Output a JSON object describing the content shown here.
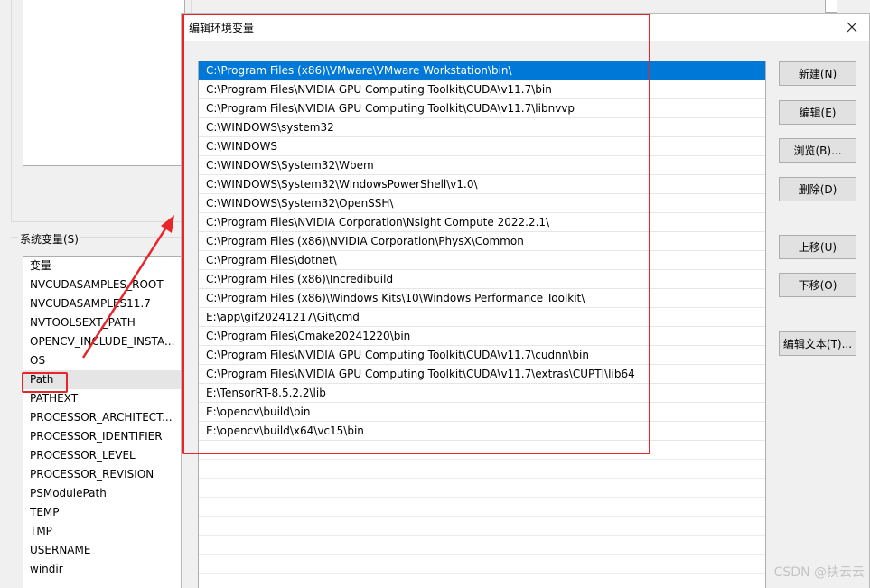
{
  "system_vars": {
    "group_label": "系统变量(S)",
    "column_header": "变量",
    "items": [
      "NVCUDASAMPLES_ROOT",
      "NVCUDASAMPLES11.7",
      "NVTOOLSEXT_PATH",
      "OPENCV_INCLUDE_INSTA...",
      "OS",
      "Path",
      "PATHEXT",
      "PROCESSOR_ARCHITECT...",
      "PROCESSOR_IDENTIFIER",
      "PROCESSOR_LEVEL",
      "PROCESSOR_REVISION",
      "PSModulePath",
      "TEMP",
      "TMP",
      "USERNAME",
      "windir"
    ],
    "selected": "Path"
  },
  "edit_dialog": {
    "title": "编辑环境变量",
    "paths": [
      "C:\\Program Files (x86)\\VMware\\VMware Workstation\\bin\\",
      "C:\\Program Files\\NVIDIA GPU Computing Toolkit\\CUDA\\v11.7\\bin",
      "C:\\Program Files\\NVIDIA GPU Computing Toolkit\\CUDA\\v11.7\\libnvvp",
      "C:\\WINDOWS\\system32",
      "C:\\WINDOWS",
      "C:\\WINDOWS\\System32\\Wbem",
      "C:\\WINDOWS\\System32\\WindowsPowerShell\\v1.0\\",
      "C:\\WINDOWS\\System32\\OpenSSH\\",
      "C:\\Program Files\\NVIDIA Corporation\\Nsight Compute 2022.2.1\\",
      "C:\\Program Files (x86)\\NVIDIA Corporation\\PhysX\\Common",
      "C:\\Program Files\\dotnet\\",
      "C:\\Program Files (x86)\\Incredibuild",
      "C:\\Program Files (x86)\\Windows Kits\\10\\Windows Performance Toolkit\\",
      "E:\\app\\gif20241217\\Git\\cmd",
      "C:\\Program Files\\Cmake20241220\\bin",
      "C:\\Program Files\\NVIDIA GPU Computing Toolkit\\CUDA\\v11.7\\cudnn\\bin",
      "C:\\Program Files\\NVIDIA GPU Computing Toolkit\\CUDA\\v11.7\\extras\\CUPTI\\lib64",
      "E:\\TensorRT-8.5.2.2\\lib",
      "E:\\opencv\\build\\bin",
      "E:\\opencv\\build\\x64\\vc15\\bin"
    ],
    "selected_index": 0,
    "buttons": {
      "new": "新建(N)",
      "edit": "编辑(E)",
      "browse": "浏览(B)...",
      "delete": "删除(D)",
      "move_up": "上移(U)",
      "move_down": "下移(O)",
      "edit_text": "编辑文本(T)..."
    }
  },
  "watermark": "CSDN @扶云云",
  "colors": {
    "selection": "#0078d7",
    "annotation_red": "#e8262a"
  }
}
